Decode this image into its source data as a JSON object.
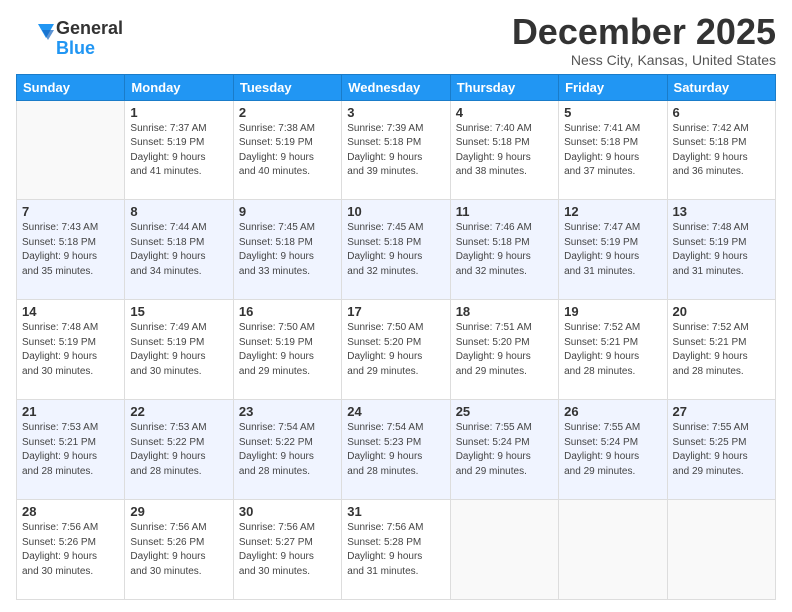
{
  "logo": {
    "general": "General",
    "blue": "Blue"
  },
  "title": "December 2025",
  "subtitle": "Ness City, Kansas, United States",
  "days_of_week": [
    "Sunday",
    "Monday",
    "Tuesday",
    "Wednesday",
    "Thursday",
    "Friday",
    "Saturday"
  ],
  "weeks": [
    [
      {
        "day": "",
        "info": ""
      },
      {
        "day": "1",
        "info": "Sunrise: 7:37 AM\nSunset: 5:19 PM\nDaylight: 9 hours\nand 41 minutes."
      },
      {
        "day": "2",
        "info": "Sunrise: 7:38 AM\nSunset: 5:19 PM\nDaylight: 9 hours\nand 40 minutes."
      },
      {
        "day": "3",
        "info": "Sunrise: 7:39 AM\nSunset: 5:18 PM\nDaylight: 9 hours\nand 39 minutes."
      },
      {
        "day": "4",
        "info": "Sunrise: 7:40 AM\nSunset: 5:18 PM\nDaylight: 9 hours\nand 38 minutes."
      },
      {
        "day": "5",
        "info": "Sunrise: 7:41 AM\nSunset: 5:18 PM\nDaylight: 9 hours\nand 37 minutes."
      },
      {
        "day": "6",
        "info": "Sunrise: 7:42 AM\nSunset: 5:18 PM\nDaylight: 9 hours\nand 36 minutes."
      }
    ],
    [
      {
        "day": "7",
        "info": "Sunrise: 7:43 AM\nSunset: 5:18 PM\nDaylight: 9 hours\nand 35 minutes."
      },
      {
        "day": "8",
        "info": "Sunrise: 7:44 AM\nSunset: 5:18 PM\nDaylight: 9 hours\nand 34 minutes."
      },
      {
        "day": "9",
        "info": "Sunrise: 7:45 AM\nSunset: 5:18 PM\nDaylight: 9 hours\nand 33 minutes."
      },
      {
        "day": "10",
        "info": "Sunrise: 7:45 AM\nSunset: 5:18 PM\nDaylight: 9 hours\nand 32 minutes."
      },
      {
        "day": "11",
        "info": "Sunrise: 7:46 AM\nSunset: 5:18 PM\nDaylight: 9 hours\nand 32 minutes."
      },
      {
        "day": "12",
        "info": "Sunrise: 7:47 AM\nSunset: 5:19 PM\nDaylight: 9 hours\nand 31 minutes."
      },
      {
        "day": "13",
        "info": "Sunrise: 7:48 AM\nSunset: 5:19 PM\nDaylight: 9 hours\nand 31 minutes."
      }
    ],
    [
      {
        "day": "14",
        "info": "Sunrise: 7:48 AM\nSunset: 5:19 PM\nDaylight: 9 hours\nand 30 minutes."
      },
      {
        "day": "15",
        "info": "Sunrise: 7:49 AM\nSunset: 5:19 PM\nDaylight: 9 hours\nand 30 minutes."
      },
      {
        "day": "16",
        "info": "Sunrise: 7:50 AM\nSunset: 5:19 PM\nDaylight: 9 hours\nand 29 minutes."
      },
      {
        "day": "17",
        "info": "Sunrise: 7:50 AM\nSunset: 5:20 PM\nDaylight: 9 hours\nand 29 minutes."
      },
      {
        "day": "18",
        "info": "Sunrise: 7:51 AM\nSunset: 5:20 PM\nDaylight: 9 hours\nand 29 minutes."
      },
      {
        "day": "19",
        "info": "Sunrise: 7:52 AM\nSunset: 5:21 PM\nDaylight: 9 hours\nand 28 minutes."
      },
      {
        "day": "20",
        "info": "Sunrise: 7:52 AM\nSunset: 5:21 PM\nDaylight: 9 hours\nand 28 minutes."
      }
    ],
    [
      {
        "day": "21",
        "info": "Sunrise: 7:53 AM\nSunset: 5:21 PM\nDaylight: 9 hours\nand 28 minutes."
      },
      {
        "day": "22",
        "info": "Sunrise: 7:53 AM\nSunset: 5:22 PM\nDaylight: 9 hours\nand 28 minutes."
      },
      {
        "day": "23",
        "info": "Sunrise: 7:54 AM\nSunset: 5:22 PM\nDaylight: 9 hours\nand 28 minutes."
      },
      {
        "day": "24",
        "info": "Sunrise: 7:54 AM\nSunset: 5:23 PM\nDaylight: 9 hours\nand 28 minutes."
      },
      {
        "day": "25",
        "info": "Sunrise: 7:55 AM\nSunset: 5:24 PM\nDaylight: 9 hours\nand 29 minutes."
      },
      {
        "day": "26",
        "info": "Sunrise: 7:55 AM\nSunset: 5:24 PM\nDaylight: 9 hours\nand 29 minutes."
      },
      {
        "day": "27",
        "info": "Sunrise: 7:55 AM\nSunset: 5:25 PM\nDaylight: 9 hours\nand 29 minutes."
      }
    ],
    [
      {
        "day": "28",
        "info": "Sunrise: 7:56 AM\nSunset: 5:26 PM\nDaylight: 9 hours\nand 30 minutes."
      },
      {
        "day": "29",
        "info": "Sunrise: 7:56 AM\nSunset: 5:26 PM\nDaylight: 9 hours\nand 30 minutes."
      },
      {
        "day": "30",
        "info": "Sunrise: 7:56 AM\nSunset: 5:27 PM\nDaylight: 9 hours\nand 30 minutes."
      },
      {
        "day": "31",
        "info": "Sunrise: 7:56 AM\nSunset: 5:28 PM\nDaylight: 9 hours\nand 31 minutes."
      },
      {
        "day": "",
        "info": ""
      },
      {
        "day": "",
        "info": ""
      },
      {
        "day": "",
        "info": ""
      }
    ]
  ]
}
